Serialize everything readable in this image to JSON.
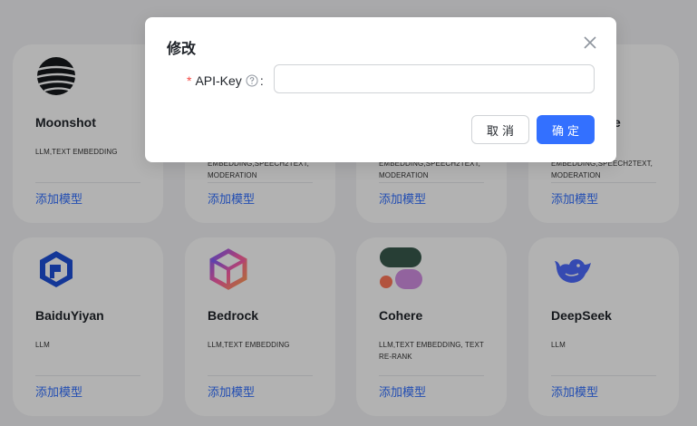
{
  "providers": [
    {
      "name": "Moonshot",
      "tags": "LLM,TEXT EMBEDDING",
      "action": "添加模型",
      "icon": "moonshot-logo-icon"
    },
    {
      "name": "",
      "tags": "EMBEDDING,SPEECH2TEXT, MODERATION",
      "action": "添加模型",
      "icon": ""
    },
    {
      "name": "",
      "tags": "EMBEDDING,SPEECH2TEXT, MODERATION",
      "action": "添加模型",
      "icon": ""
    },
    {
      "name": "e",
      "tags": "EMBEDDING,SPEECH2TEXT, MODERATION",
      "action": "添加模型",
      "icon": ""
    },
    {
      "name": "BaiduYiyan",
      "tags": "LLM",
      "action": "添加模型",
      "icon": "baiduyiyan-logo-icon"
    },
    {
      "name": "Bedrock",
      "tags": "LLM,TEXT EMBEDDING",
      "action": "添加模型",
      "icon": "bedrock-logo-icon"
    },
    {
      "name": "Cohere",
      "tags": "LLM,TEXT EMBEDDING, TEXT RE-RANK",
      "action": "添加模型",
      "icon": "cohere-logo-icon"
    },
    {
      "name": "DeepSeek",
      "tags": "LLM",
      "action": "添加模型",
      "icon": "deepseek-logo-icon"
    }
  ],
  "modal": {
    "title": "修改",
    "field_required_mark": "*",
    "field_label": "API-Key",
    "field_colon": ":",
    "field_value": "",
    "help_icon": "question-circle-icon",
    "close_icon": "close-icon",
    "cancel_label": "取消",
    "confirm_label": "确定"
  },
  "colors": {
    "accent": "#3370ff",
    "required": "#f54a45",
    "overlay": "rgba(0,0,0,0.30)"
  }
}
